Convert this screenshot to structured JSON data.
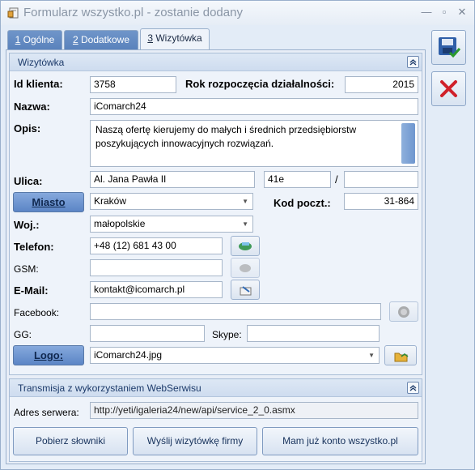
{
  "window": {
    "title": "Formularz wszystko.pl - zostanie dodany"
  },
  "tabs": [
    {
      "num": "1",
      "label": " Ogólne"
    },
    {
      "num": "2",
      "label": " Dodatkowe"
    },
    {
      "num": "3",
      "label": " Wizytówka"
    }
  ],
  "wizytowka": {
    "header": "Wizytówka",
    "id_label": "Id klienta:",
    "id_value": "3758",
    "rok_label": "Rok rozpoczęcia działalności:",
    "rok_value": "2015",
    "nazwa_label": "Nazwa:",
    "nazwa_value": "iComarch24",
    "opis_label": "Opis:",
    "opis_value": "Naszą ofertę kierujemy do małych i średnich przedsiębiorstw poszykujących innowacyjnych rozwiązań.",
    "ulica_label": "Ulica:",
    "ulica_value": "Al. Jana Pawła II",
    "nr_domu": "41e",
    "slash": "/",
    "nr_lokalu": "",
    "miasto_button": "Miasto",
    "miasto_value": "Kraków",
    "kod_label": "Kod poczt.:",
    "kod_value": "31-864",
    "woj_label": "Woj.:",
    "woj_value": "małopolskie",
    "telefon_label": "Telefon:",
    "telefon_value": "+48 (12) 681 43 00",
    "gsm_label": "GSM:",
    "gsm_value": "",
    "email_label": "E-Mail:",
    "email_value": "kontakt@icomarch.pl",
    "facebook_label": "Facebook:",
    "facebook_value": "",
    "gg_label": "GG:",
    "gg_value": "",
    "skype_label": "Skype:",
    "skype_value": "",
    "logo_button": "Logo:",
    "logo_value": "iComarch24.jpg"
  },
  "transmisja": {
    "header": "Transmisja z wykorzystaniem WebSerwisu",
    "adres_label": "Adres serwera:",
    "adres_value": "http://yeti/igaleria24/new/api/service_2_0.asmx",
    "btn_slowniki": "Pobierz słowniki",
    "btn_wyslij": "Wyślij wizytówkę firmy",
    "btn_konto": "Mam już konto wszystko.pl"
  },
  "colors": {
    "accent": "#5b85c6",
    "cancel": "#d0202a",
    "save": "#2f5fa8"
  }
}
